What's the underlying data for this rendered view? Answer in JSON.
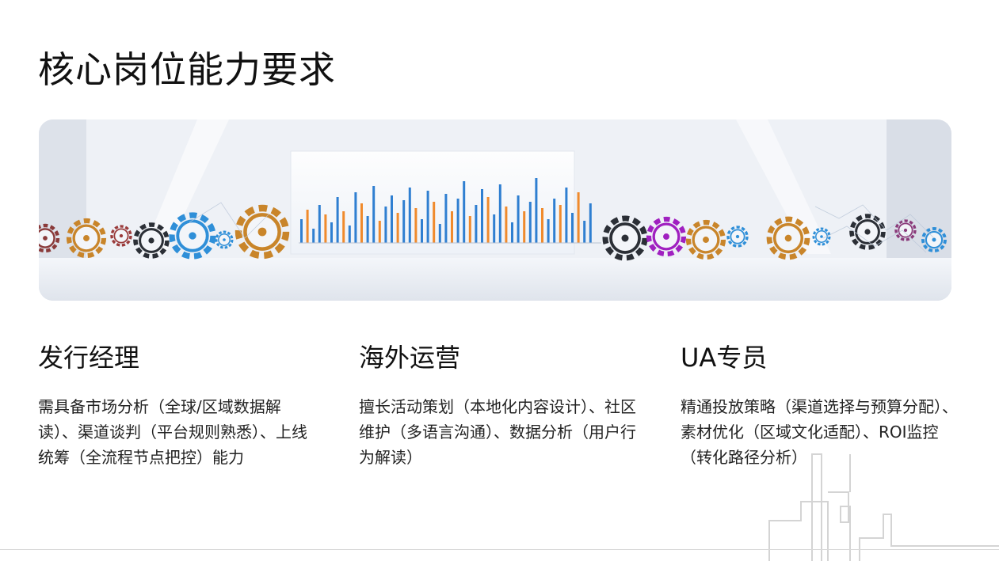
{
  "page": {
    "title": "核心岗位能力要求"
  },
  "roles": [
    {
      "title": "发行经理",
      "description": "需具备市场分析（全球/区域数据解读）、渠道谈判（平台规则熟悉）、上线统筹（全流程节点把控）能力"
    },
    {
      "title": "海外运营",
      "description": "擅长活动策划（本地化内容设计）、社区维护（多语言沟通）、数据分析（用户行为解读）"
    },
    {
      "title": "UA专员",
      "description": "精通投放策略（渠道选择与预算分配）、素材优化（区域文化适配）、ROI监控（转化路径分析）"
    }
  ],
  "colors": {
    "bar_blue": "#2f7fd1",
    "bar_orange": "#f08a2c",
    "gear_gold": "#c9852a",
    "gear_blue": "#2f8fd8",
    "gear_purple": "#a020c0",
    "gear_dark": "#2b2f36"
  }
}
